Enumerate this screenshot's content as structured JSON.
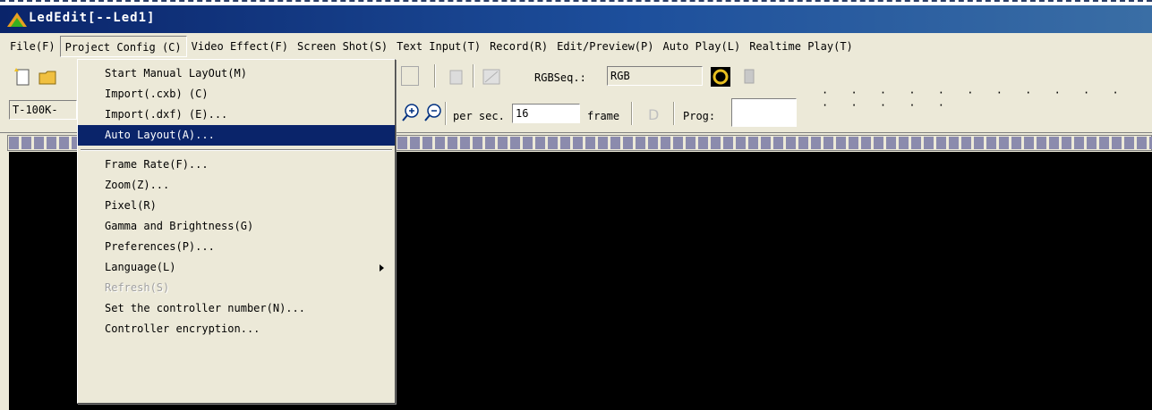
{
  "window": {
    "title": "LedEdit[--Led1]"
  },
  "menubar": {
    "items": [
      {
        "label": "File(F)"
      },
      {
        "label": "Project Config (C)",
        "active": true
      },
      {
        "label": "Video Effect(F)"
      },
      {
        "label": "Screen Shot(S)"
      },
      {
        "label": "Text Input(T)"
      },
      {
        "label": "Record(R)"
      },
      {
        "label": "Edit/Preview(P)"
      },
      {
        "label": "Auto Play(L)"
      },
      {
        "label": "Realtime Play(T)"
      }
    ]
  },
  "toolbar": {
    "rgbseq_label": "RGBSeq.:",
    "rgbseq_value": "RGB",
    "combo_value": "T-100K-",
    "per_sec_label": "per sec.",
    "fps_value": "16",
    "frame_label": "frame",
    "prog_label": "Prog:",
    "prog_value": "",
    "slider_ticks": "· · · · · · · · · · · · · · · ·"
  },
  "dropdown": {
    "items": [
      {
        "label": "Start Manual LayOut(M)"
      },
      {
        "label": "Import(.cxb) (C)"
      },
      {
        "label": "Import(.dxf) (E)..."
      },
      {
        "label": "Auto Layout(A)...",
        "highlighted": true
      },
      {
        "separator": true
      },
      {
        "label": "Frame Rate(F)..."
      },
      {
        "label": "Zoom(Z)..."
      },
      {
        "label": "Pixel(R)"
      },
      {
        "label": "Gamma and Brightness(G)"
      },
      {
        "label": "Preferences(P)..."
      },
      {
        "label": "Language(L)",
        "submenu": true
      },
      {
        "label": "Refresh(S)",
        "disabled": true
      },
      {
        "label": "Set the controller number(N)..."
      },
      {
        "label": "Controller encryption..."
      }
    ]
  },
  "colors": {
    "titlebar": "#0a246a",
    "highlight": "#0a246a",
    "canvas": "#000000",
    "face": "#ece9d8"
  },
  "icons": [
    "new-file-icon",
    "open-folder-icon",
    "zoom-in-icon",
    "zoom-out-icon",
    "color-ring-icon"
  ]
}
